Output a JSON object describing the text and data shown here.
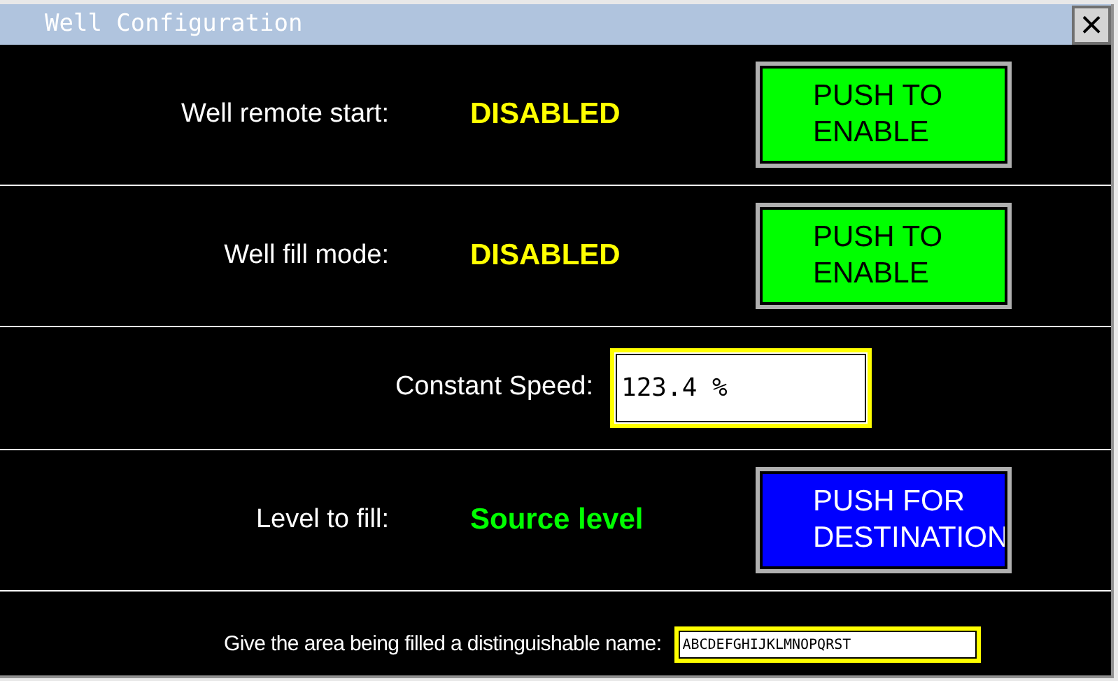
{
  "window": {
    "title": "Well Configuration",
    "close_label": "×"
  },
  "rows": [
    {
      "kind": "status",
      "label": "Well remote start:",
      "value": "DISABLED",
      "color": "#ffff00",
      "button": {
        "label": "PUSH TO ENABLE",
        "color": "#00ff00"
      }
    },
    {
      "kind": "status",
      "label": "Well fill mode:",
      "value": "DISABLED",
      "color": "#ffff00",
      "button": {
        "label": "PUSH TO ENABLE",
        "color": "#00ff00"
      }
    },
    {
      "kind": "field",
      "label": "Constant Speed:",
      "value": "123.4 %"
    },
    {
      "kind": "status",
      "label": "Level to fill:",
      "value": "Source level",
      "color": "#00ff00",
      "button": {
        "label": "PUSH FOR DESTINATION",
        "color": "#0000ff"
      }
    }
  ],
  "name_field": {
    "label": "Give the area being filled a distinguishable name:",
    "value": "ABCDEFGHIJKLMNOPQRST"
  }
}
